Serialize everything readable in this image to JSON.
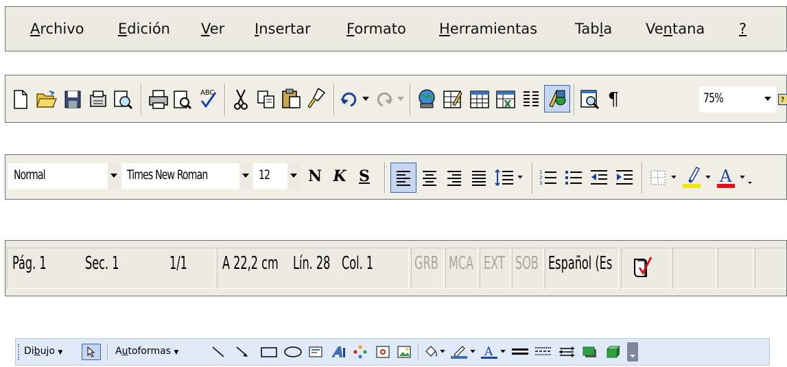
{
  "menu": {
    "archivo": {
      "pre": "",
      "u": "A",
      "post": "rchivo"
    },
    "edicion": {
      "pre": "",
      "u": "E",
      "post": "dición"
    },
    "ver": {
      "pre": "",
      "u": "V",
      "post": "er"
    },
    "insertar": {
      "pre": "",
      "u": "I",
      "post": "nsertar"
    },
    "formato": {
      "pre": "",
      "u": "F",
      "post": "ormato"
    },
    "herramientas": {
      "pre": "",
      "u": "H",
      "post": "erramientas"
    },
    "tabla": {
      "pre": "Tab",
      "u": "l",
      "post": "a"
    },
    "ventana": {
      "pre": "Ve",
      "u": "n",
      "post": "tana"
    },
    "help": {
      "pre": "",
      "u": "?",
      "post": ""
    }
  },
  "standard": {
    "zoom": "75%",
    "pilcrow": "¶"
  },
  "format": {
    "style": "Normal",
    "font": "Times New Roman",
    "size": "12",
    "bold": "N",
    "italic": "K",
    "underline": "S"
  },
  "status": {
    "page": "Pág. 1",
    "section": "Sec. 1",
    "pages": "1/1",
    "at": "A 22,2 cm",
    "line": "Lín. 28",
    "col": "Col. 1",
    "grb": "GRB",
    "mca": "MCA",
    "ext": "EXT",
    "sob": "SOB",
    "lang": "Español (Es"
  },
  "drawing": {
    "dibujo": {
      "pre": "Di",
      "u": "b",
      "post": "ujo"
    },
    "autoformas": {
      "pre": "A",
      "u": "u",
      "post": "toformas"
    }
  }
}
